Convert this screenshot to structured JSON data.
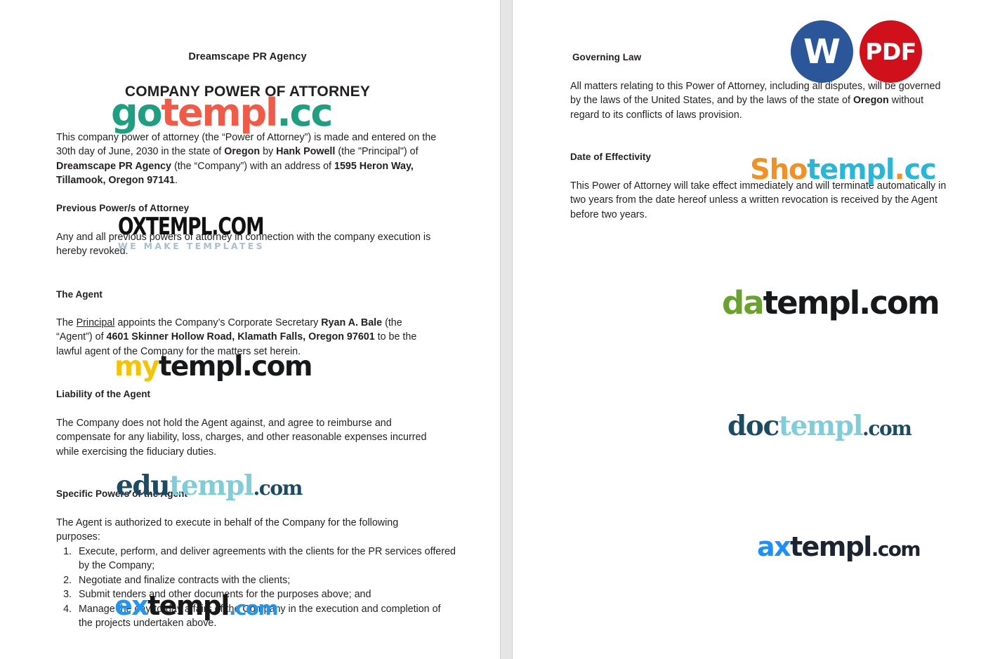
{
  "document": {
    "company_name": "Dreamscape PR Agency",
    "title": "COMPANY POWER OF ATTORNEY",
    "intro_paragraph": "This company power of attorney (the “Power of Attorney”) is made and entered on the 30th day of June, 2030 in the state of Oregon by Hank Powell (the \"Principal\") of Dreamscape PR Agency (the “Company”) with an address of 1595 Heron Way, Tillamook, Oregon 97141.",
    "sections": {
      "previous_power": {
        "heading": "Previous Power/s of Attorney",
        "body": "Any and all previous powers of attorney in connection with the company execution is hereby revoked."
      },
      "the_agent": {
        "heading": "The Agent",
        "body": "The Principal appoints the Company’s Corporate Secretary Ryan A. Bale (the “Agent”) of 4601 Skinner Hollow Road, Klamath Falls, Oregon 97601 to be the lawful agent of the Company for the matters set herein."
      },
      "liability": {
        "heading": "Liability of the Agent",
        "body": "The Company does not hold the Agent against, and agree to reimburse and compensate for any liability, loss, charges, and other reasonable expenses incurred while exercising the fiduciary duties."
      },
      "specific_powers": {
        "heading": "Specific Powers of the Agent",
        "lead_in": "The Agent is authorized to execute in behalf of the Company for the following purposes:",
        "items": [
          "Execute, perform, and deliver agreements with the clients for the PR services offered by the Company;",
          "Negotiate and finalize contracts with the clients;",
          "Submit tenders and other documents for the purposes above; and",
          "Manage the day-to-day affairs of the Company in the execution and completion of the projects undertaken above."
        ]
      },
      "governing_law": {
        "heading": "Governing Law",
        "body": "All matters relating to this Power of Attorney, including all disputes, will be governed by the laws of the United States, and by the laws of the state of Oregon without regard to its conflicts of laws provision."
      },
      "date_of_effectivity": {
        "heading": "Date of Effectivity",
        "body": "This Power of Attorney will take effect immediately and will terminate automatically in two years from the date hereof unless a written revocation is received by the Agent before two years."
      }
    },
    "inline_terms": {
      "state": "Oregon",
      "principal_name": "Hank Powell",
      "company": "Dreamscape PR Agency",
      "company_address": "1595 Heron Way, Tillamook, Oregon 97141",
      "agent_name": "Ryan A. Bale",
      "agent_address": "4601 Skinner Hollow Road, Klamath Falls, Oregon 97601",
      "principal_label": "Principal"
    }
  },
  "badges": [
    {
      "name": "word-format-badge",
      "label": "W",
      "color": "#2b579a"
    },
    {
      "name": "pdf-format-badge",
      "label": "PDF",
      "color": "#d0111b"
    }
  ],
  "watermarks": {
    "gotempl": {
      "part1": "go",
      "part2": "templ",
      "part3": ".cc",
      "color1": "#1f9e81",
      "color2": "#f05a46"
    },
    "oxtempl": {
      "word": "OXTEMPL.COM",
      "tagline": "WE MAKE TEMPLATES",
      "color": "#111111",
      "tagline_color": "#a8c0c9"
    },
    "mytempl": {
      "part1": "my",
      "part2": "templ.com",
      "color1": "#f5c400",
      "color2": "#16181a"
    },
    "edutempl": {
      "part1": "edu",
      "part2": "templ",
      "part3": ".com",
      "color1": "#1c4b63",
      "color2": "#7fcdd8"
    },
    "extempl": {
      "part1": "ex",
      "part2": "templ",
      "part3": ".com",
      "color1": "#2196f3",
      "color2": "#16181a"
    },
    "shotempl": {
      "part1": "Sho",
      "part2": "templ",
      "part3": ".",
      "part4": "cc",
      "color1": "#f29024",
      "color2": "#29b6d8"
    },
    "datempl": {
      "part1": "da",
      "part2": "templ.com",
      "color1": "#6aa22e",
      "color2": "#16181a"
    },
    "doctempl": {
      "part1": "doc",
      "part2": "templ",
      "part3": ".com",
      "color1": "#1c4b63",
      "color2": "#7fcdd8"
    },
    "axtempl": {
      "part1": "ax",
      "part2": "templ",
      "part3": ".com",
      "color1": "#1f8fff",
      "color2": "#1b2430"
    }
  }
}
